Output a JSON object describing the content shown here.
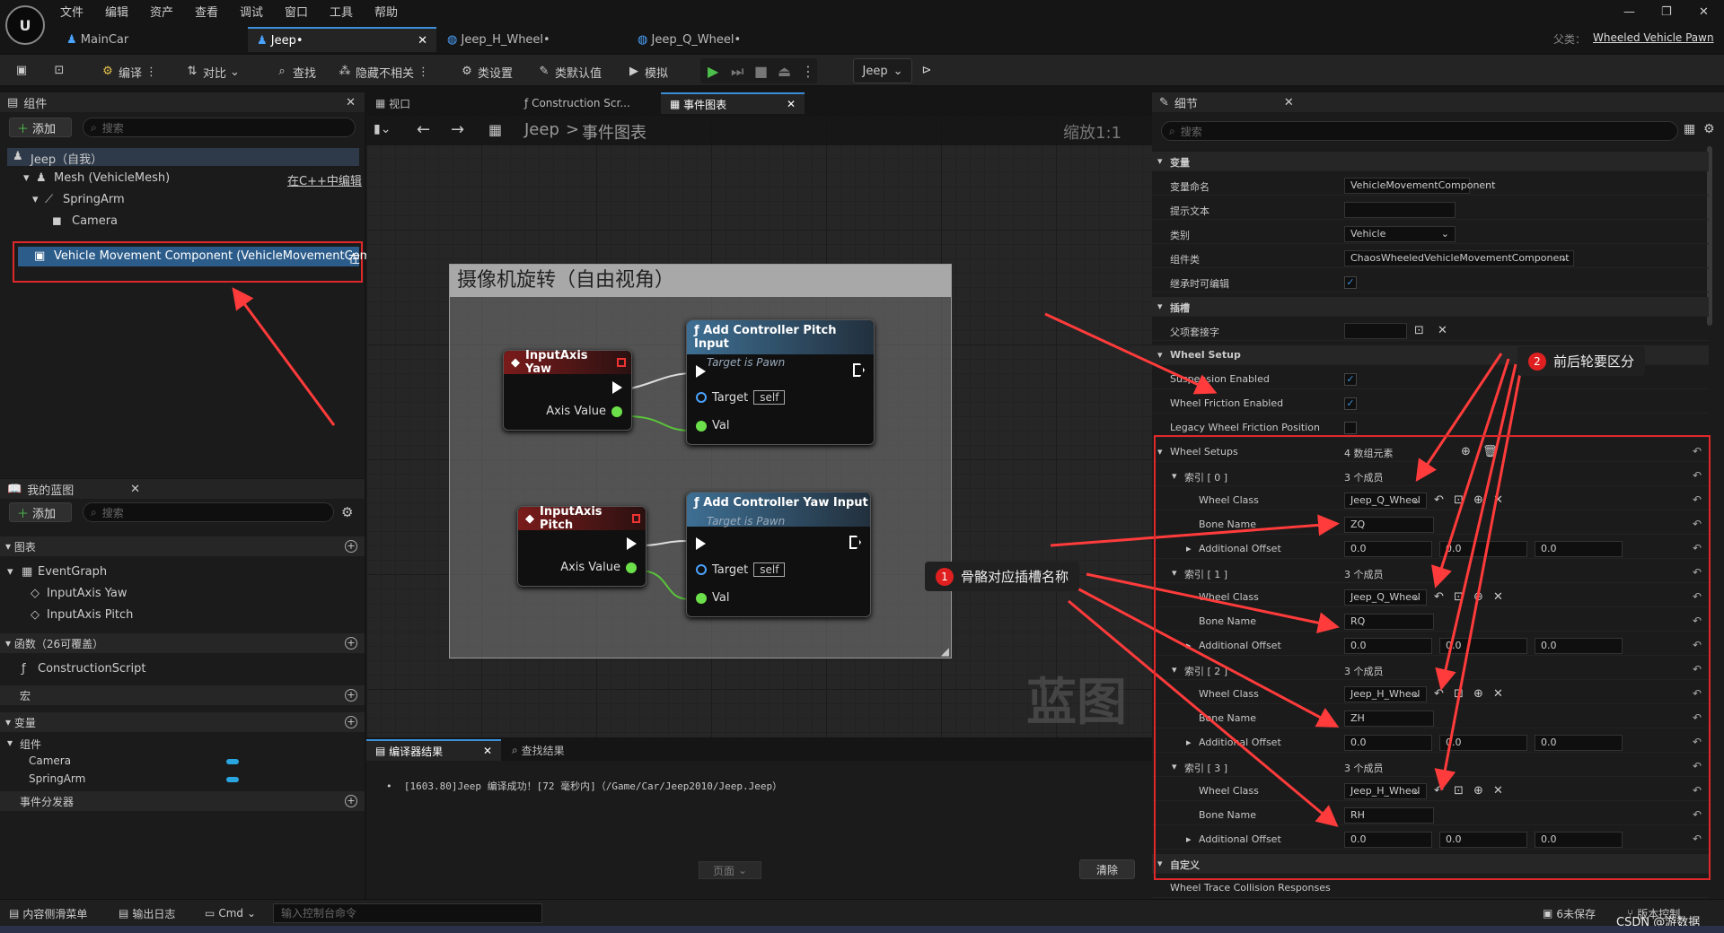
{
  "menu": [
    "文件",
    "编辑",
    "资产",
    "查看",
    "调试",
    "窗口",
    "工具",
    "帮助"
  ],
  "tabs": [
    {
      "label": "MainCar"
    },
    {
      "label": "Jeep•"
    },
    {
      "label": "Jeep_H_Wheel•"
    },
    {
      "label": "Jeep_Q_Wheel•"
    }
  ],
  "parent_label": "父类：",
  "parent_value": "Wheeled Vehicle Pawn",
  "toolbar": {
    "compile": "编译",
    "diff": "对比",
    "find": "查找",
    "hide": "隐藏不相关",
    "class_settings": "类设置",
    "class_defaults": "类默认值",
    "simulate": "模拟",
    "debug_target": "Jeep"
  },
  "components": {
    "title": "组件",
    "add": "添加",
    "search_placeholder": "搜索",
    "root": "Jeep（自我）",
    "mesh": "Mesh (VehicleMesh)",
    "edit_cpp": "在C++中编辑",
    "spring": "SpringArm",
    "camera": "Camera",
    "vmc": "Vehicle Movement Component (VehicleMovementComp)",
    "vmc_suffix": "在"
  },
  "editor_tabs": {
    "viewport": "视口",
    "construction": "Construction Scr...",
    "event_graph": "事件图表"
  },
  "breadcrumb": {
    "root": "Jeep",
    "sep": ">",
    "page": "事件图表"
  },
  "zoom": "缩放1:1",
  "watermark": "蓝图",
  "comment_title": "摄像机旋转（自由视角）",
  "nodes": {
    "yaw_event": "InputAxis Yaw",
    "axis_value": "Axis Value",
    "pitch_event": "InputAxis Pitch",
    "add_pitch": "Add Controller Pitch Input",
    "add_yaw": "Add Controller Yaw Input",
    "target_is_pawn": "Target is Pawn",
    "target": "Target",
    "self": "self",
    "val": "Val"
  },
  "mybp": {
    "title": "我的蓝图",
    "add": "添加",
    "search_placeholder": "搜索",
    "graphs": "图表",
    "event_graph": "EventGraph",
    "yaw": "InputAxis Yaw",
    "pitch": "InputAxis Pitch",
    "functions": "函数（26可覆盖）",
    "construction": "ConstructionScript",
    "macros": "宏",
    "variables": "变量",
    "components": "组件",
    "var_camera": "Camera",
    "var_spring": "SpringArm",
    "dispatchers": "事件分发器"
  },
  "compiler": {
    "tab1": "编译器结果",
    "tab2": "查找结果",
    "message": "[1603.80]Jeep 编译成功！[72 毫秒内]（/Game/Car/Jeep2010/Jeep.Jeep）",
    "page": "页面",
    "clear": "清除"
  },
  "details": {
    "title": "细节",
    "search_placeholder": "搜索",
    "sec_variable": "变量",
    "var_name_label": "变量命名",
    "var_name": "VehicleMovementComponent",
    "tooltip_label": "提示文本",
    "category_label": "类别",
    "category": "Vehicle",
    "component_class_label": "组件类",
    "component_class": "ChaosWheeledVehicleMovementComponent",
    "editable_label": "继承时可编辑",
    "sec_socket": "插槽",
    "parent_socket_label": "父项套接字",
    "sec_wheel_setup": "Wheel Setup",
    "suspension_label": "Suspension Enabled",
    "friction_label": "Wheel Friction Enabled",
    "legacy_label": "Legacy Wheel Friction Position",
    "wheel_setups_label": "Wheel Setups",
    "wheel_setups_count": "4 数组元素",
    "members": "3 个成员",
    "wheel_class_label": "Wheel Class",
    "bone_name_label": "Bone Name",
    "offset_label": "Additional Offset",
    "indices": [
      {
        "label": "索引 [ 0 ]",
        "wheel_class": "Jeep_Q_Wheel",
        "bone": "ZQ",
        "offset": [
          "0.0",
          "0.0",
          "0.0"
        ]
      },
      {
        "label": "索引 [ 1 ]",
        "wheel_class": "Jeep_Q_Wheel",
        "bone": "RQ",
        "offset": [
          "0.0",
          "0.0",
          "0.0"
        ]
      },
      {
        "label": "索引 [ 2 ]",
        "wheel_class": "Jeep_H_Wheel",
        "bone": "ZH",
        "offset": [
          "0.0",
          "0.0",
          "0.0"
        ]
      },
      {
        "label": "索引 [ 3 ]",
        "wheel_class": "Jeep_H_Wheel",
        "bone": "RH",
        "offset": [
          "0.0",
          "0.0",
          "0.0"
        ]
      }
    ],
    "custom": "自定义",
    "truncated": "Wheel Trace Collision Responses"
  },
  "annotations": {
    "a1_num": "1",
    "a1": "骨骼对应插槽名称",
    "a2_num": "2",
    "a2": "前后轮要区分"
  },
  "status": {
    "drawer": "内容侧滑菜单",
    "output": "输出日志",
    "cmd": "Cmd",
    "console_placeholder": "输入控制台命令",
    "unsaved": "6未保存",
    "source": "版本控制",
    "credit": "CSDN @游数据"
  },
  "colors": {
    "accent": "#3b8fd9",
    "annotation_red": "#ff3b3b",
    "selection_outline": "#e0282a"
  }
}
